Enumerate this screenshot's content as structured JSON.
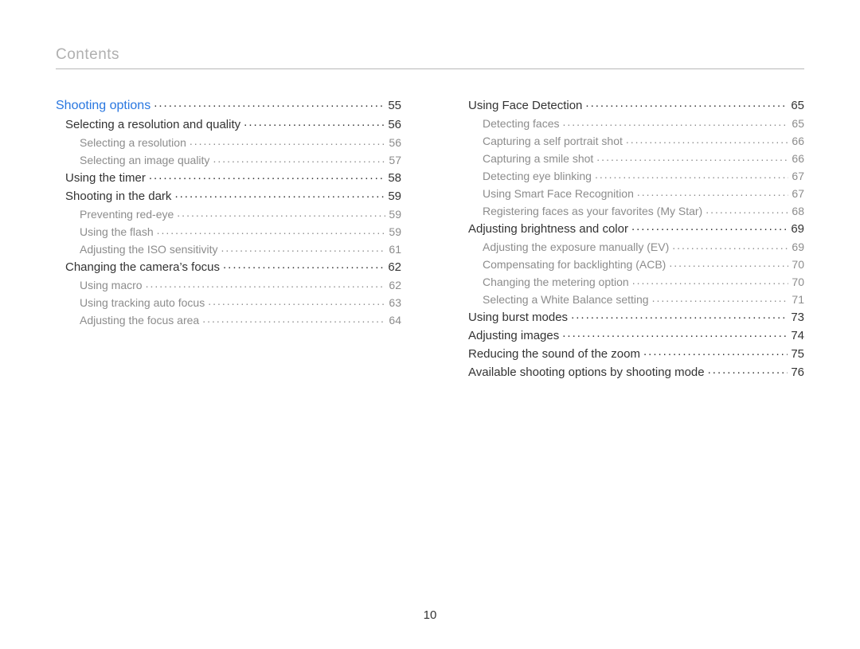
{
  "header": {
    "title": "Contents"
  },
  "footer": {
    "page_number": "10"
  },
  "columns": [
    [
      {
        "level": "section",
        "label": "Shooting options",
        "page": "55"
      },
      {
        "level": "topic",
        "label": "Selecting a resolution and quality",
        "page": "56"
      },
      {
        "level": "sub",
        "label": "Selecting a resolution",
        "page": "56"
      },
      {
        "level": "sub",
        "label": "Selecting an image quality",
        "page": "57"
      },
      {
        "level": "topic",
        "label": "Using the timer",
        "page": "58"
      },
      {
        "level": "topic",
        "label": "Shooting in the dark",
        "page": "59"
      },
      {
        "level": "sub",
        "label": "Preventing red-eye",
        "page": "59"
      },
      {
        "level": "sub",
        "label": "Using the flash",
        "page": "59"
      },
      {
        "level": "sub",
        "label": "Adjusting the ISO sensitivity",
        "page": "61"
      },
      {
        "level": "topic",
        "label": "Changing the camera’s focus",
        "page": "62"
      },
      {
        "level": "sub",
        "label": "Using macro",
        "page": "62"
      },
      {
        "level": "sub",
        "label": "Using tracking auto focus",
        "page": "63"
      },
      {
        "level": "sub",
        "label": "Adjusting the focus area",
        "page": "64"
      }
    ],
    [
      {
        "level": "topic",
        "label": "Using Face Detection",
        "page": "65"
      },
      {
        "level": "sub",
        "label": "Detecting faces",
        "page": "65"
      },
      {
        "level": "sub",
        "label": "Capturing a self portrait shot",
        "page": "66"
      },
      {
        "level": "sub",
        "label": "Capturing a smile shot",
        "page": "66"
      },
      {
        "level": "sub",
        "label": "Detecting eye blinking",
        "page": "67"
      },
      {
        "level": "sub",
        "label": "Using Smart Face Recognition",
        "page": "67"
      },
      {
        "level": "sub",
        "label": "Registering faces as your favorites (My Star)",
        "page": "68"
      },
      {
        "level": "topic",
        "label": "Adjusting brightness and color",
        "page": "69"
      },
      {
        "level": "sub",
        "label": "Adjusting the exposure manually (EV)",
        "page": "69"
      },
      {
        "level": "sub",
        "label": "Compensating for backlighting (ACB)",
        "page": "70"
      },
      {
        "level": "sub",
        "label": "Changing the metering option",
        "page": "70"
      },
      {
        "level": "sub",
        "label": "Selecting a White Balance setting",
        "page": "71"
      },
      {
        "level": "topic",
        "label": "Using burst modes",
        "page": "73"
      },
      {
        "level": "topic",
        "label": "Adjusting images",
        "page": "74"
      },
      {
        "level": "topic",
        "label": "Reducing the sound of the zoom",
        "page": "75"
      },
      {
        "level": "topic",
        "label": "Available shooting options by shooting mode",
        "page": "76"
      }
    ]
  ]
}
